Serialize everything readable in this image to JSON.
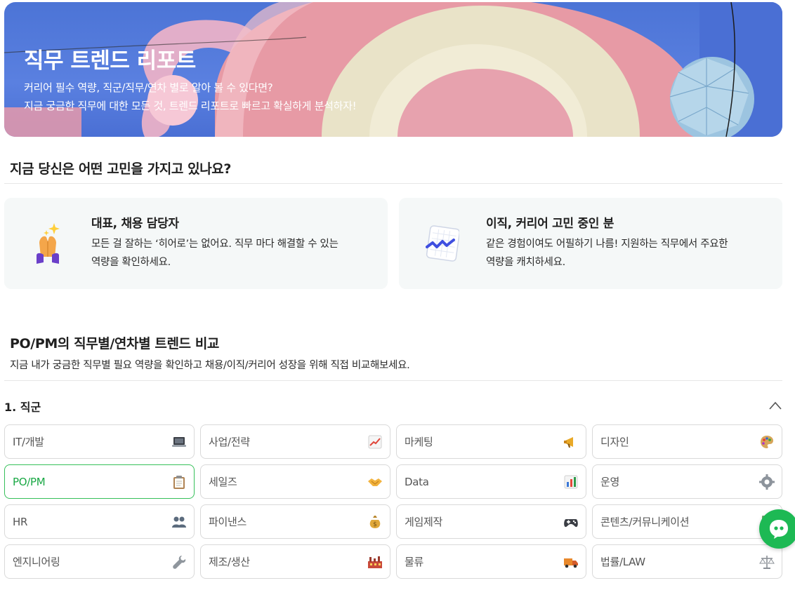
{
  "hero": {
    "title": "직무 트렌드 리포트",
    "subtitle_line1": "커리어 필수 역량, 직군/직무/연차 별로 알아 볼 수 있다면?",
    "subtitle_line2": "지금 궁금한 직무에 대한 모든 것, 트렌드 리포트로 빠르고 확실하게 분석하자!"
  },
  "question": {
    "title": "지금 당신은 어떤 고민을 가지고 있나요?"
  },
  "cards": [
    {
      "icon": "praying-hands-icon",
      "title": "대표, 채용 담당자",
      "line1": "모든 걸 잘하는 ‘히어로’는 없어요. 직무 마다 해결할 수 있는",
      "line2": "역량을 확인하세요."
    },
    {
      "icon": "chart-card-icon",
      "title": "이직, 커리어 고민 중인 분",
      "line1": "같은 경험이여도 어필하기 나름! 지원하는 직무에서 주요한",
      "line2": "역량을 캐치하세요."
    }
  ],
  "compare": {
    "title": "PO/PM의 직무별/연차별 트렌드 비교",
    "subtitle": "지금 내가 궁금한 직무별 필요 역량을 확인하고 채용/이직/커리어 성장을 위해 직접 비교해보세요.",
    "category_label": "1. 직군"
  },
  "job_groups": [
    {
      "label": "IT/개발",
      "icon": "laptop-icon",
      "selected": false
    },
    {
      "label": "사업/전략",
      "icon": "chart-up-icon",
      "selected": false
    },
    {
      "label": "마케팅",
      "icon": "megaphone-icon",
      "selected": false
    },
    {
      "label": "디자인",
      "icon": "palette-icon",
      "selected": false
    },
    {
      "label": "PO/PM",
      "icon": "clipboard-icon",
      "selected": true
    },
    {
      "label": "세일즈",
      "icon": "handshake-icon",
      "selected": false
    },
    {
      "label": "Data",
      "icon": "bar-chart-icon",
      "selected": false
    },
    {
      "label": "운영",
      "icon": "gear-icon",
      "selected": false
    },
    {
      "label": "HR",
      "icon": "people-icon",
      "selected": false
    },
    {
      "label": "파이낸스",
      "icon": "money-bag-icon",
      "selected": false
    },
    {
      "label": "게임제작",
      "icon": "gamepad-icon",
      "selected": false
    },
    {
      "label": "콘텐츠/커뮤니케이션",
      "icon": "document-icon",
      "selected": false
    },
    {
      "label": "엔지니어링",
      "icon": "wrench-icon",
      "selected": false
    },
    {
      "label": "제조/생산",
      "icon": "factory-icon",
      "selected": false
    },
    {
      "label": "물류",
      "icon": "truck-icon",
      "selected": false
    },
    {
      "label": "법률/LAW",
      "icon": "scales-icon",
      "selected": false
    }
  ],
  "colors": {
    "accent_green": "#1aa845",
    "selected_border": "#36c05a",
    "hero_blue": "#4c74d6",
    "fab_green": "#1db954"
  }
}
